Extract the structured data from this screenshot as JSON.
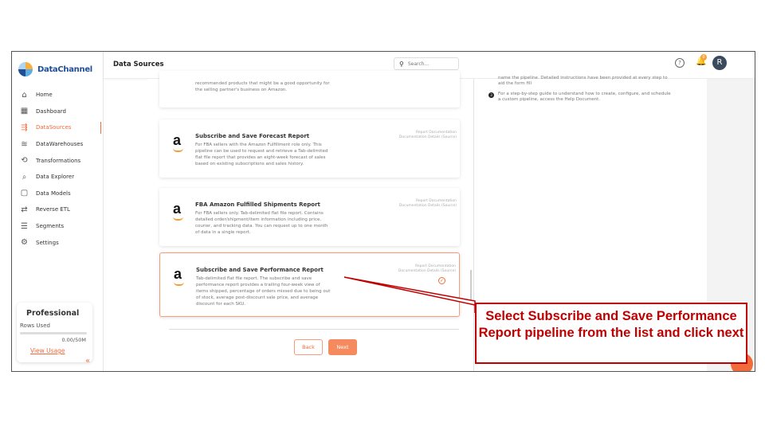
{
  "app": {
    "brand": "DataChannel"
  },
  "sidebar": {
    "items": [
      {
        "label": "Home",
        "icon": "home-icon",
        "glyph": "⌂"
      },
      {
        "label": "Dashboard",
        "icon": "dashboard-icon",
        "glyph": "▦"
      },
      {
        "label": "DataSources",
        "icon": "datasources-icon",
        "glyph": "⇶",
        "active": true
      },
      {
        "label": "DataWarehouses",
        "icon": "database-icon",
        "glyph": "≋"
      },
      {
        "label": "Transformations",
        "icon": "transform-icon",
        "glyph": "⟲"
      },
      {
        "label": "Data Explorer",
        "icon": "explorer-icon",
        "glyph": "⌕"
      },
      {
        "label": "Data Models",
        "icon": "models-icon",
        "glyph": "▢"
      },
      {
        "label": "Reverse ETL",
        "icon": "reverse-etl-icon",
        "glyph": "⇄"
      },
      {
        "label": "Segments",
        "icon": "segments-icon",
        "glyph": "☰"
      },
      {
        "label": "Settings",
        "icon": "settings-icon",
        "glyph": "⚙"
      }
    ],
    "plan": {
      "title": "Professional",
      "rows_used_label": "Rows Used",
      "usage_value": "0.00/50M",
      "usage_fraction": 0.0,
      "view_usage": "View Usage"
    },
    "collapse_glyph": "«"
  },
  "header": {
    "title": "Data Sources",
    "search_placeholder": "Search...",
    "help_glyph": "?",
    "notification_count": "0",
    "avatar_initial": "R"
  },
  "cards": [
    {
      "title": "",
      "desc": "recommended products that might be a good opportunity for the selling partner's business on Amazon.",
      "links": ""
    },
    {
      "title": "Subscribe and Save Forecast Report",
      "desc": "For FBA sellers with the Amazon Fulfillment role only. This pipeline can be used to request and retrieve a Tab-delimited flat file report that provides an eight-week forecast of sales based on existing subscriptions and sales history.",
      "links": "Report Documentation\nDocumentation Details (Source)"
    },
    {
      "title": "FBA Amazon Fulfilled Shipments Report",
      "desc": "For FBA sellers only. Tab-delimited flat file report. Contains detailed order/shipment/item information including price, courier, and tracking data. You can request up to one month of data in a single report.",
      "links": "Report Documentation\nDocumentation Details (Source)"
    },
    {
      "title": "Subscribe and Save Performance Report",
      "desc": "Tab-delimited flat file report. The subscribe and save performance report provides a trailing four-week view of items shipped, percentage of orders missed due to being out of stock, average post-discount sale price, and average discount for each SKU.",
      "links": "Report Documentation\nDocumentation Details (Source)",
      "selected": true
    }
  ],
  "card_logo_glyph": "a",
  "buttons": {
    "back": "Back",
    "next": "Next"
  },
  "instructions": [
    {
      "text": "name the pipeline. Detailed instructions have been provided at every step to aid the form fill",
      "num": ""
    },
    {
      "text": "For a step-by-step guide to understand how to create, configure, and schedule a custom pipeline, access the Help Document.",
      "num": "3"
    }
  ],
  "callout": {
    "text": "Select Subscribe and Save Performance Report pipeline from the list and click next"
  },
  "colors": {
    "accent": "#f26b3a",
    "callout": "#c00000",
    "brand": "#1f4e96"
  }
}
